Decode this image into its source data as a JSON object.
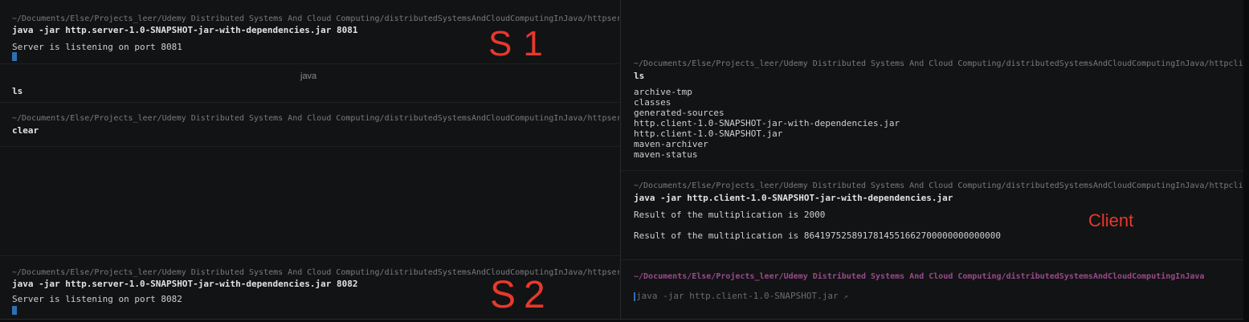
{
  "left": {
    "s1": {
      "path": "~/Documents/Else/Projects_leer/Udemy Distributed Systems And Cloud Computing/distributedSystemsAndCloudComputingInJava/httpserver",
      "command": "java -jar http.server-1.0-SNAPSHOT-jar-with-dependencies.jar 8081",
      "output": "Server is listening on port 8081"
    },
    "java_title": "java",
    "ls_block": {
      "command": "ls"
    },
    "clear_block": {
      "path": "~/Documents/Else/Projects_leer/Udemy Distributed Systems And Cloud Computing/distributedSystemsAndCloudComputingInJava/httpserver",
      "command": "clear"
    },
    "s2": {
      "path": "~/Documents/Else/Projects_leer/Udemy Distributed Systems And Cloud Computing/distributedSystemsAndCloudComputingInJava/httpserver",
      "command": "java -jar http.server-1.0-SNAPSHOT-jar-with-dependencies.jar 8082",
      "output": "Server is listening on port 8082"
    }
  },
  "right": {
    "ls_block": {
      "path": "~/Documents/Else/Projects_leer/Udemy Distributed Systems And Cloud Computing/distributedSystemsAndCloudComputingInJava/httpclient",
      "command": "ls",
      "entries": [
        "archive-tmp",
        "classes",
        "generated-sources",
        "http.client-1.0-SNAPSHOT-jar-with-dependencies.jar",
        "http.client-1.0-SNAPSHOT.jar",
        "maven-archiver",
        "maven-status"
      ]
    },
    "run_block": {
      "path": "~/Documents/Else/Projects_leer/Udemy Distributed Systems And Cloud Computing/distributedSystemsAndCloudComputingInJava/httpclient",
      "command": "java -jar http.client-1.0-SNAPSHOT-jar-with-dependencies.jar",
      "result1": "Result of the multiplication is 2000",
      "result2": "Result of the multiplication is 8641975258917814551662700000000000000"
    },
    "prompt": {
      "path": "~/Documents/Else/Projects_leer/Udemy Distributed Systems And Cloud Computing/distributedSystemsAndCloudComputingInJava",
      "input": "java -jar http.client-1.0-SNAPSHOT.jar"
    }
  },
  "annotations": {
    "s1": "S1",
    "s2": "S2",
    "client": "Client"
  },
  "colors": {
    "background": "#121314",
    "annotation": "#e8382c",
    "cursor": "#2f6fb3",
    "prompt_path": "#9a4a8a"
  }
}
